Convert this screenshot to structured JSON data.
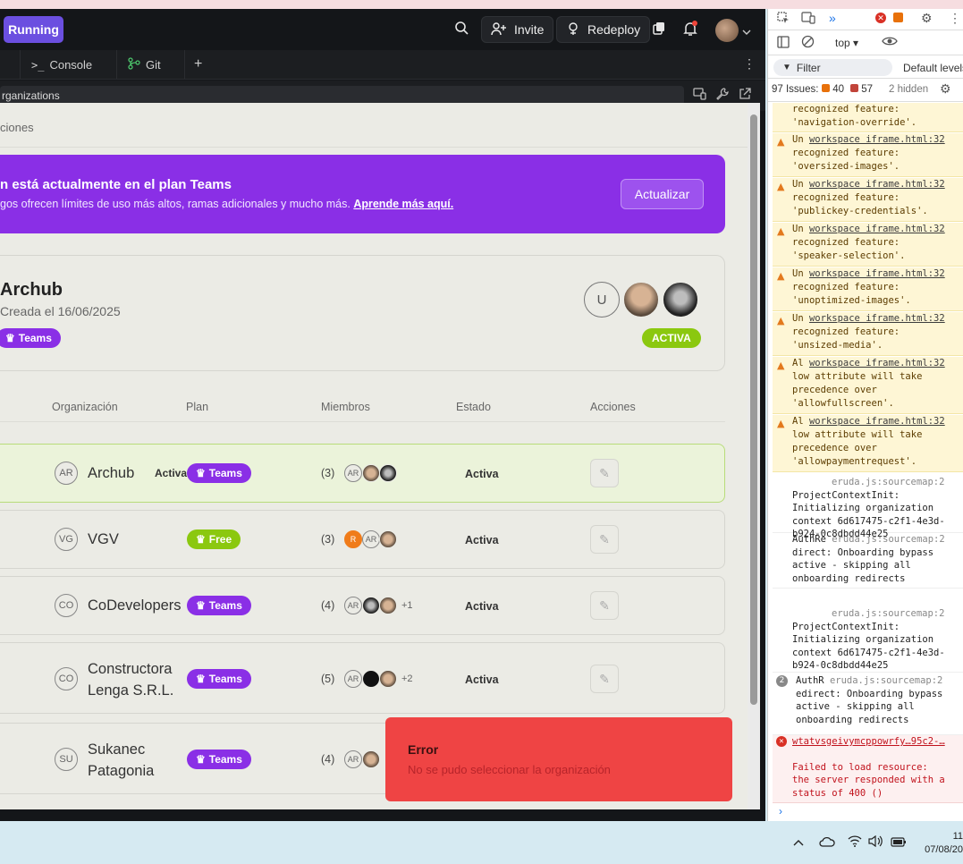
{
  "topbar": {
    "status_label": "Running",
    "invite_label": "Invite",
    "redeploy_label": "Redeploy"
  },
  "tabs": [
    {
      "label": "Console",
      "icon": ">_"
    },
    {
      "label": "Git",
      "icon": "git-branch-icon"
    }
  ],
  "url": "rganizations",
  "breadcrumb": "ciones",
  "banner": {
    "title": "n está actualmente en el plan Teams",
    "text": "gos ofrecen límites de uso más altos, ramas adicionales y mucho más.",
    "link": "Aprende más aquí.",
    "button": "Actualizar",
    "color": "#8a2fe6"
  },
  "current_org": {
    "name": "Archub",
    "created": "Creada el 16/06/2025",
    "plan": "Teams",
    "status": "ACTIVA",
    "avatar_initial": "U"
  },
  "table": {
    "headers": [
      "Organización",
      "Plan",
      "Miembros",
      "Estado",
      "Acciones"
    ],
    "rows": [
      {
        "initials": "AR",
        "name": "Archub",
        "extra": "Activa",
        "plan": "Teams",
        "count": "(3)",
        "members": [
          "AR"
        ],
        "more": "",
        "status": "Activa"
      },
      {
        "initials": "VG",
        "name": "VGV",
        "extra": "",
        "plan": "Free",
        "count": "(3)",
        "members": [
          "R",
          "AR"
        ],
        "more": "",
        "status": "Activa"
      },
      {
        "initials": "CO",
        "name": "CoDevelopers",
        "extra": "",
        "plan": "Teams",
        "count": "(4)",
        "members": [
          "AR"
        ],
        "more": "+1",
        "status": "Activa"
      },
      {
        "initials": "CO",
        "name": "Constructora",
        "name2": "Lenga S.R.L.",
        "extra": "",
        "plan": "Teams",
        "count": "(5)",
        "members": [
          "AR"
        ],
        "more": "+2",
        "status": "Activa"
      },
      {
        "initials": "SU",
        "name": "Sukanec",
        "name2": "Patagonia",
        "extra": "",
        "plan": "Teams",
        "count": "(4)",
        "members": [
          "AR"
        ],
        "more": "",
        "status": ""
      }
    ]
  },
  "toast": {
    "title": "Error",
    "message": "No se pudo seleccionar la organización",
    "color": "#ef4444"
  },
  "devtools": {
    "context": "top",
    "filter_placeholder": "Filter",
    "levels": "Default levels",
    "issues_label": "97 Issues:",
    "warn_count": "40",
    "info_count": "57",
    "hidden": "2 hidden",
    "logs": [
      {
        "type": "warn-cont",
        "lines": [
          "recognized feature:",
          "'navigation-override'."
        ]
      },
      {
        "type": "warn",
        "prefix": "Un",
        "src": "workspace iframe.html:32",
        "lines": [
          "recognized feature:",
          "'oversized-images'."
        ]
      },
      {
        "type": "warn",
        "prefix": "Un",
        "src": "workspace iframe.html:32",
        "lines": [
          "recognized feature:",
          "'publickey-credentials'."
        ]
      },
      {
        "type": "warn",
        "prefix": "Un",
        "src": "workspace iframe.html:32",
        "lines": [
          "recognized feature:",
          "'speaker-selection'."
        ]
      },
      {
        "type": "warn",
        "prefix": "Un",
        "src": "workspace iframe.html:32",
        "lines": [
          "recognized feature:",
          "'unoptimized-images'."
        ]
      },
      {
        "type": "warn",
        "prefix": "Un",
        "src": "workspace iframe.html:32",
        "lines": [
          "recognized feature:",
          "'unsized-media'."
        ]
      },
      {
        "type": "warn",
        "prefix": "Al",
        "src": "workspace iframe.html:32",
        "lines": [
          "low attribute will take",
          "precedence over",
          "'allowfullscreen'."
        ]
      },
      {
        "type": "warn",
        "prefix": "Al",
        "src": "workspace iframe.html:32",
        "lines": [
          "low attribute will take",
          "precedence over",
          "'allowpaymentrequest'."
        ]
      },
      {
        "type": "log",
        "prefix": "",
        "src": "eruda.js:sourcemap:2",
        "lines": [
          "ProjectContextInit:",
          "Initializing organization",
          "context 6d617475-c2f1-4e3d-",
          "b924-0c8dbdd44e25"
        ]
      },
      {
        "type": "log",
        "prefix": "AuthRe",
        "src": "eruda.js:sourcemap:2",
        "lines": [
          "direct: Onboarding bypass",
          "active - skipping all",
          "onboarding redirects"
        ]
      },
      {
        "type": "log",
        "prefix": "",
        "src": "eruda.js:sourcemap:2",
        "lines": [
          "ProjectContextInit:",
          "Initializing organization",
          "context 6d617475-c2f1-4e3d-",
          "b924-0c8dbdd44e25"
        ]
      },
      {
        "type": "log",
        "prefix": "AuthR",
        "badge": "2",
        "src": "eruda.js:sourcemap:2",
        "lines": [
          "edirect: Onboarding bypass",
          "active - skipping all",
          "onboarding redirects"
        ]
      },
      {
        "type": "error",
        "src": "wtatvsgeivymcppowrfy…95c2-…",
        "lines": [
          "Failed to load resource:",
          "the server responded with a",
          "status of 400 ()"
        ]
      }
    ]
  },
  "taskbar": {
    "time": "11",
    "date": "07/08/20"
  }
}
